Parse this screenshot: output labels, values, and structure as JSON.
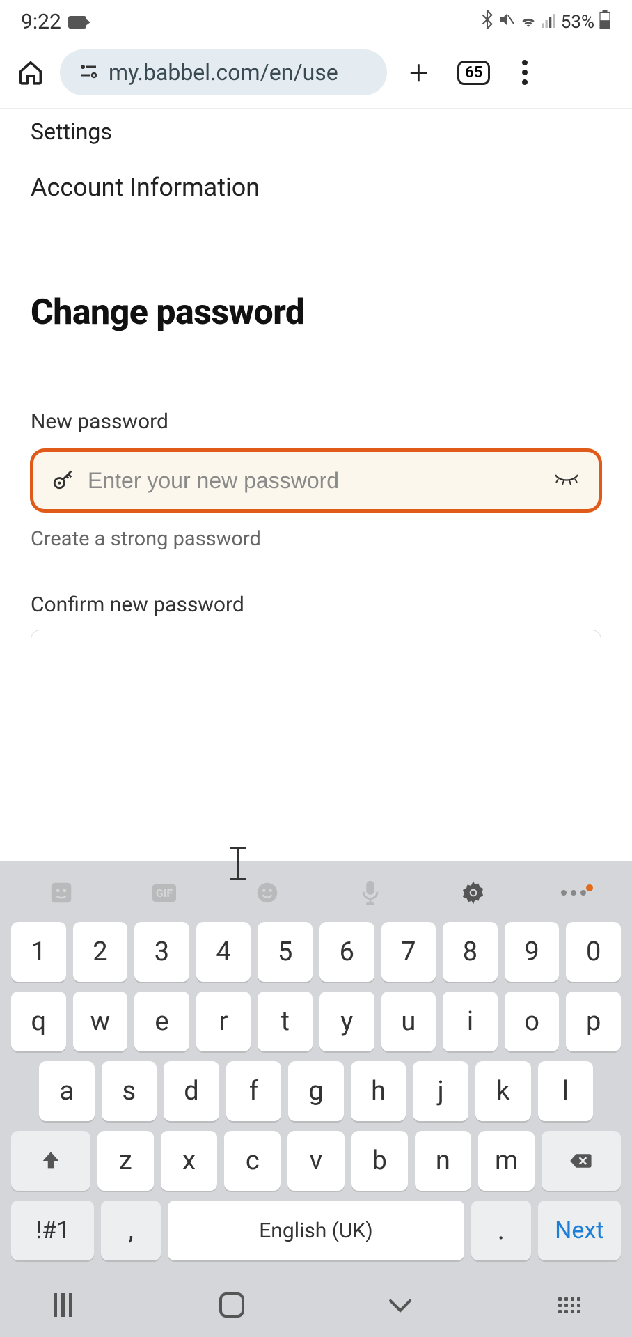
{
  "statusbar": {
    "time": "9:22",
    "battery": "53%"
  },
  "browser": {
    "url": "my.babbel.com/en/use",
    "tab_count": "65"
  },
  "page": {
    "crumb_settings": "Settings",
    "crumb_account": "Account Information",
    "heading": "Change password",
    "new_pw_label": "New password",
    "new_pw_placeholder": "Enter your new password",
    "new_pw_hint": "Create a strong password",
    "confirm_label": "Confirm new password"
  },
  "keyboard": {
    "gif": "GIF",
    "row_num": [
      "1",
      "2",
      "3",
      "4",
      "5",
      "6",
      "7",
      "8",
      "9",
      "0"
    ],
    "row_q": [
      "q",
      "w",
      "e",
      "r",
      "t",
      "y",
      "u",
      "i",
      "o",
      "p"
    ],
    "row_a": [
      "a",
      "s",
      "d",
      "f",
      "g",
      "h",
      "j",
      "k",
      "l"
    ],
    "row_z": [
      "z",
      "x",
      "c",
      "v",
      "b",
      "n",
      "m"
    ],
    "sym": "!#1",
    "comma": ",",
    "space": "English (UK)",
    "period": ".",
    "next": "Next"
  }
}
